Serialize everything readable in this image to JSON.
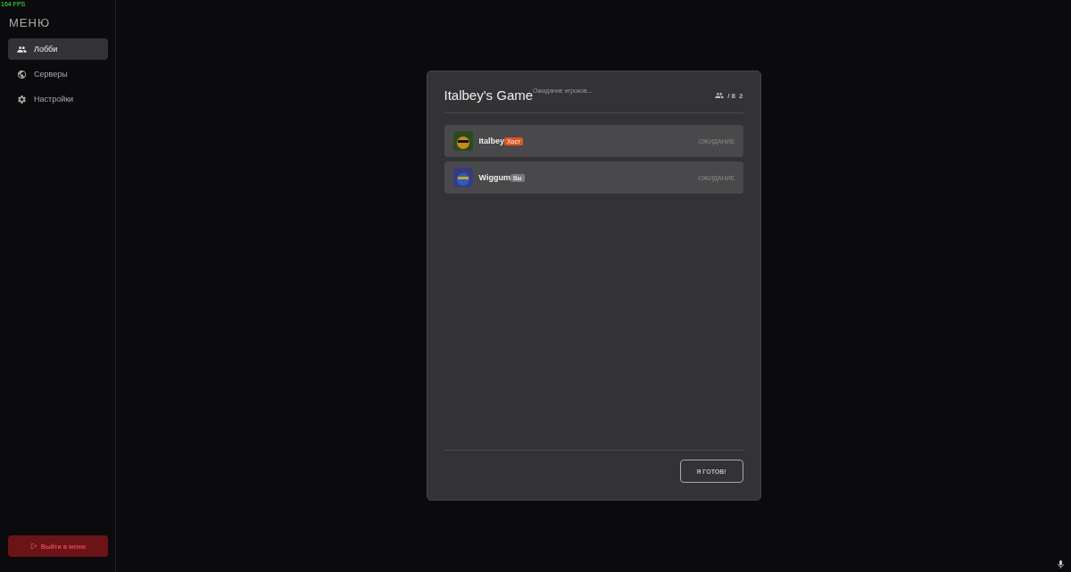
{
  "fps": "164 FPS",
  "sidebar": {
    "title": "МЕНЮ",
    "items": [
      {
        "label": "Лобби",
        "kind": "people",
        "selected": true
      },
      {
        "label": "Серверы",
        "kind": "globe",
        "selected": false
      },
      {
        "label": "Настройки",
        "kind": "gear",
        "selected": false
      }
    ],
    "exit_button": "Выйти в меню"
  },
  "lobby": {
    "title": "Italbey's Game",
    "status": "Ожидание игроков...",
    "capacity": "/ 8",
    "count": "2",
    "players": [
      {
        "name": "Italbey",
        "badge": "Хост",
        "kind": "host",
        "state": "ОЖИДАНИЕ"
      },
      {
        "name": "Wiggum",
        "badge": "Вы",
        "kind": "you",
        "state": "ОЖИДАНИЕ"
      }
    ],
    "ready_button": "Я ГОТОВ!"
  }
}
